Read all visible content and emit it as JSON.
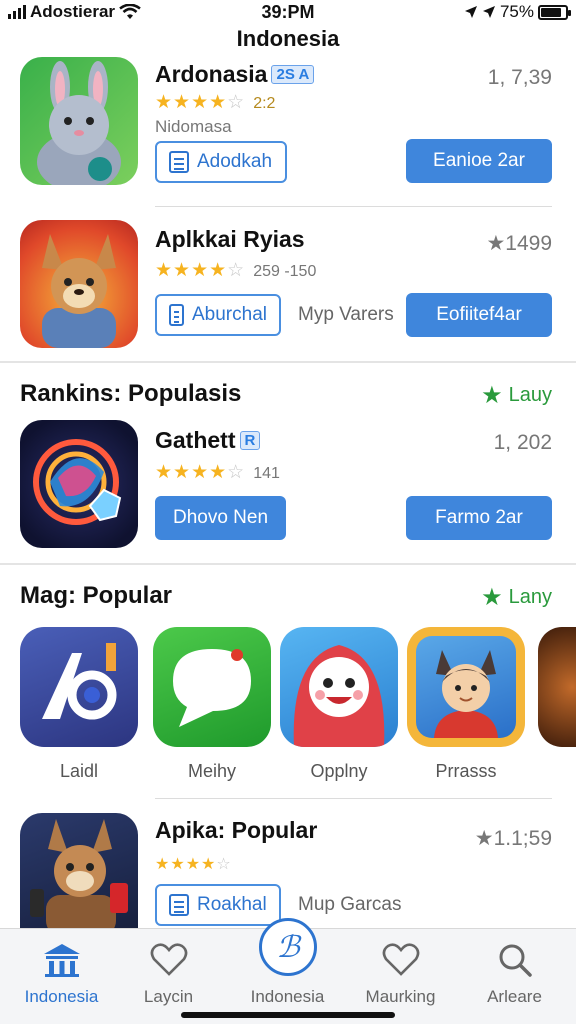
{
  "status_bar": {
    "carrier": "Adostierar",
    "time": "39:PM",
    "battery": "75%",
    "battery_level": 0.75
  },
  "page_title": "Indonesia",
  "apps": [
    {
      "name": "Ardonasia",
      "tag": "2S A",
      "rating_text": "2:2",
      "stars": 4,
      "subtitle": "Nidomasa",
      "count": "1, 7,39",
      "outline_button": "Adodkah",
      "action_button": "Eanioe 2ar"
    },
    {
      "name": "Aplkkai Ryias",
      "rating_text": "259 -150",
      "stars": 4,
      "count": "★1499",
      "outline_button": "Aburchal",
      "aside_text": "Myp Varers",
      "action_button": "Eofiitef4ar"
    }
  ],
  "section1": {
    "title": "Rankins: Populasis",
    "link": "Lauy"
  },
  "ranked_app": {
    "name": "Gathett",
    "tag": "R",
    "rating_text": "141",
    "stars": 4,
    "count": "1, 202",
    "left_button": "Dhovo Nen",
    "action_button": "Farmo 2ar"
  },
  "section2": {
    "title": "Mag: Popular",
    "link": "Lany"
  },
  "carousel": [
    {
      "label": "Laidl",
      "icon": "logo-ao-icon"
    },
    {
      "label": "Meihy",
      "icon": "chat-bubble-icon"
    },
    {
      "label": "Opplny",
      "icon": "red-hood-character-icon"
    },
    {
      "label": "Prrasss",
      "icon": "cat-boy-character-icon"
    }
  ],
  "bottom_app": {
    "name": "Apika: Popular",
    "rating_text": "",
    "stars": 4,
    "count": "★1.1;59",
    "outline_button": "Roakhal",
    "aside_text": "Mup Garcas"
  },
  "tabs": [
    {
      "label": "Indonesia",
      "icon": "building-icon",
      "active": true
    },
    {
      "label": "Laycin",
      "icon": "heart-icon",
      "active": false
    },
    {
      "label": "Indonesia",
      "icon": "script-b-icon",
      "active": false
    },
    {
      "label": "Maurking",
      "icon": "heart-icon",
      "active": false
    },
    {
      "label": "Arleare",
      "icon": "search-icon",
      "active": false
    }
  ],
  "colors": {
    "accent": "#3f86dc",
    "star": "#f6b320",
    "green": "#2a9a3c"
  }
}
